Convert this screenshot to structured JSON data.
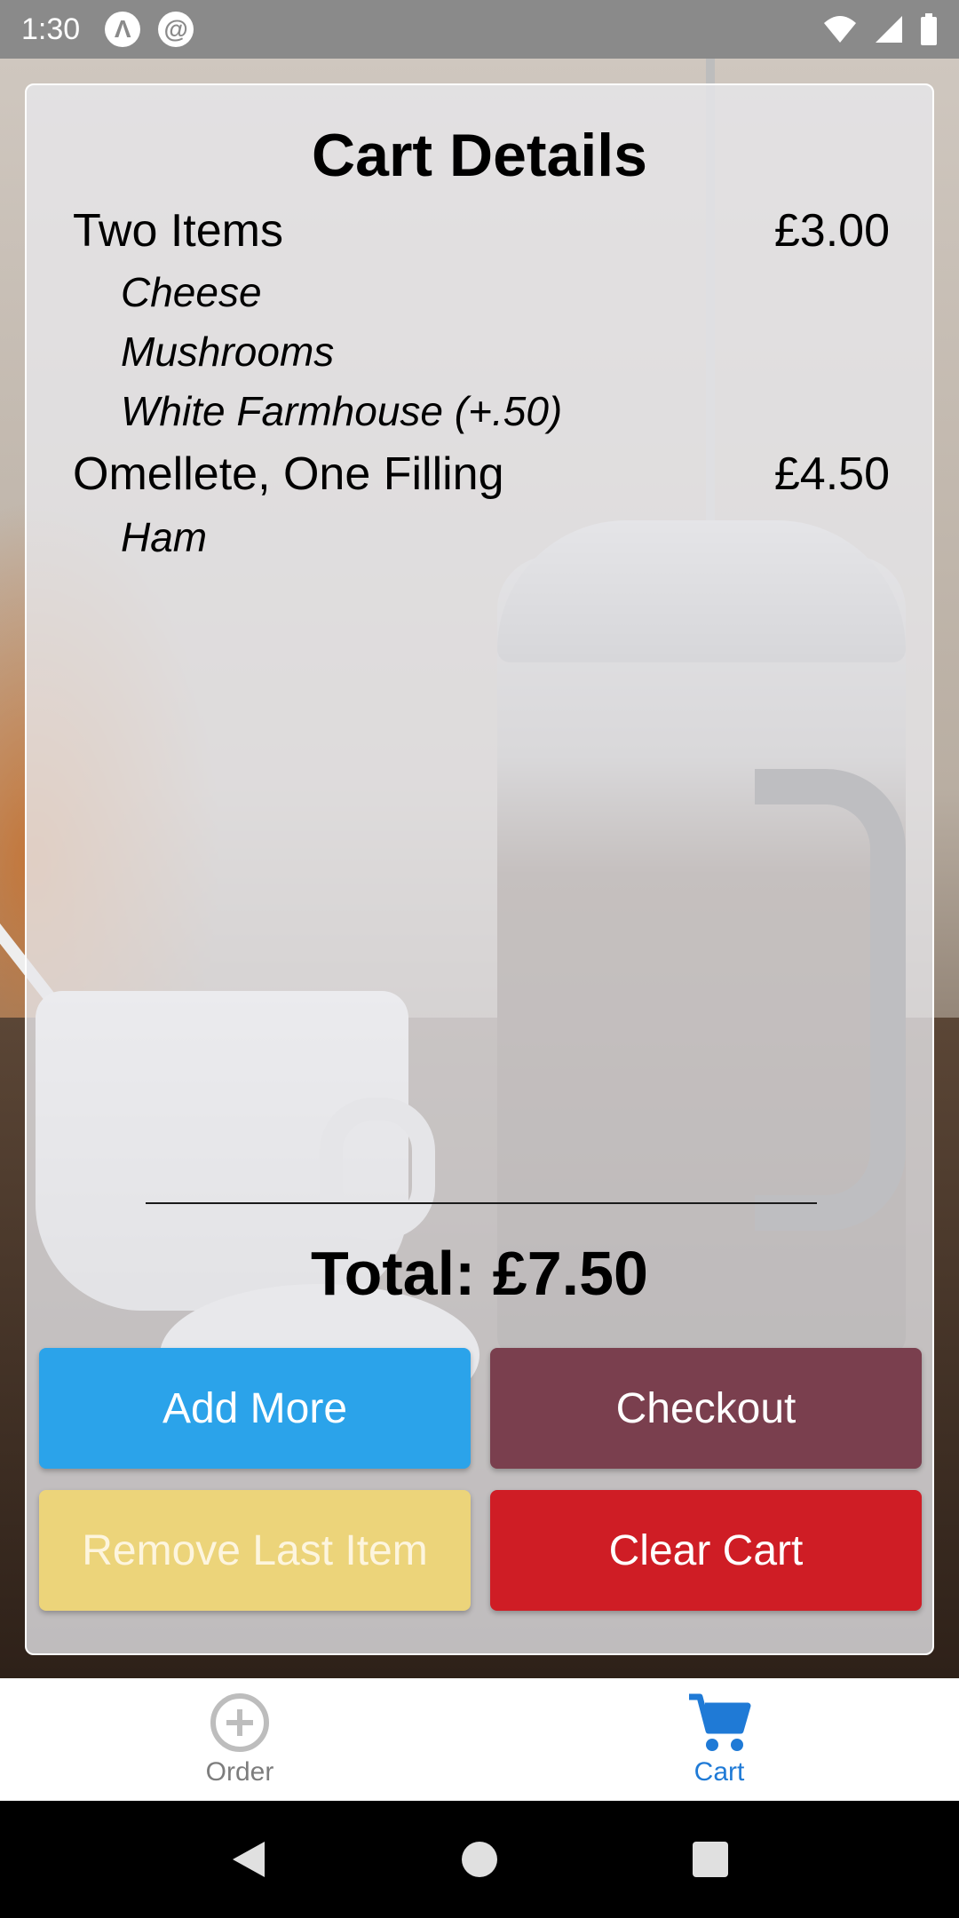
{
  "status_bar": {
    "time": "1:30",
    "icons": [
      "notification-a-icon",
      "notification-r-icon",
      "wifi-icon",
      "signal-icon",
      "battery-icon"
    ]
  },
  "cart": {
    "title": "Cart Details",
    "items": [
      {
        "name": "Two Items",
        "price": "£3.00",
        "options": [
          "Cheese",
          "Mushrooms",
          "White Farmhouse (+.50)"
        ]
      },
      {
        "name": "Omellete, One Filling",
        "price": "£4.50",
        "options": [
          "Ham"
        ]
      }
    ],
    "total": "Total: £7.50"
  },
  "buttons": {
    "add_more": "Add More",
    "checkout": "Checkout",
    "remove_last": "Remove Last Item",
    "clear_cart": "Clear Cart"
  },
  "tabs": [
    {
      "label": "Order",
      "icon": "plus-circle-icon",
      "active": false
    },
    {
      "label": "Cart",
      "icon": "shopping-cart-icon",
      "active": true
    }
  ],
  "colors": {
    "add_more": "#2ba3ea",
    "checkout": "#7a3f4e",
    "remove_last": "#ecd47a",
    "clear_cart": "#cf1d25",
    "active_tab": "#1f7ad6",
    "inactive_tab": "#7d7d7d"
  }
}
